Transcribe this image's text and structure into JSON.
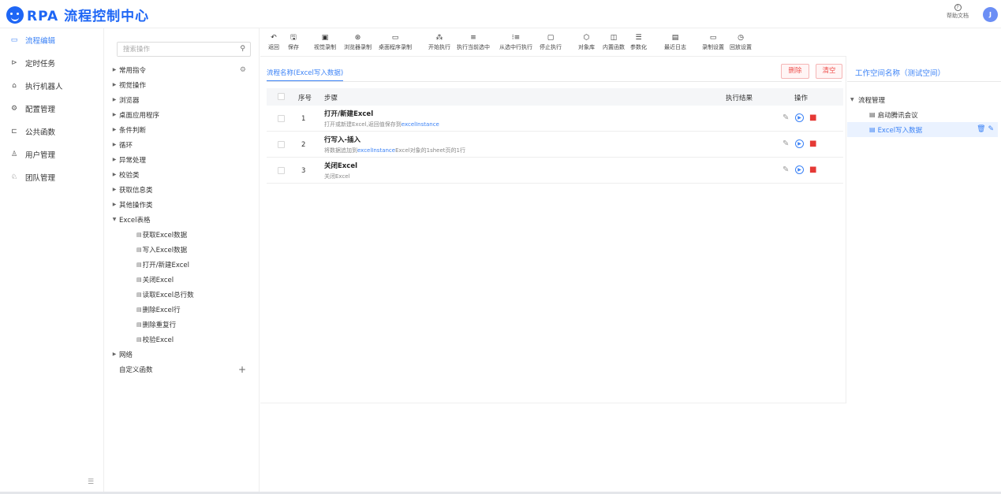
{
  "app": {
    "title": "RPA 流程控制中心",
    "help_label": "帮助文档",
    "avatar_letter": "J"
  },
  "nav": {
    "items": [
      {
        "label": "流程编辑",
        "icon": "monitor-icon"
      },
      {
        "label": "定时任务",
        "icon": "play-icon"
      },
      {
        "label": "执行机器人",
        "icon": "robot-icon"
      },
      {
        "label": "配置管理",
        "icon": "settings-icon"
      },
      {
        "label": "公共函数",
        "icon": "function-icon"
      },
      {
        "label": "用户管理",
        "icon": "user-icon"
      },
      {
        "label": "团队管理",
        "icon": "team-icon"
      }
    ],
    "active_index": 0
  },
  "ops": {
    "search_placeholder": "搜索操作",
    "categories": [
      "常用指令",
      "视觉操作",
      "浏览器",
      "桌面应用程序",
      "条件判断",
      "循环",
      "异常处理",
      "校验类",
      "获取信息类",
      "其他操作类",
      "Excel表格"
    ],
    "excel_items": [
      "获取Excel数据",
      "写入Excel数据",
      "打开/新建Excel",
      "关闭Excel",
      "读取Excel总行数",
      "删除Excel行",
      "删除重复行",
      "校验Excel"
    ],
    "after": [
      "网络"
    ],
    "custom_func": "自定义函数"
  },
  "toolbar": {
    "items": [
      {
        "label": "返回",
        "icon": "↶"
      },
      {
        "label": "保存",
        "icon": "🖫"
      },
      {
        "label": "视觉录制",
        "icon": "▣"
      },
      {
        "label": "浏览器录制",
        "icon": "⊛"
      },
      {
        "label": "桌面程序录制",
        "icon": "▭"
      },
      {
        "label": "开始执行",
        "icon": "⁂"
      },
      {
        "label": "执行当前选中",
        "icon": "≡"
      },
      {
        "label": "从选中行执行",
        "icon": "⁝≡"
      },
      {
        "label": "停止执行",
        "icon": "▢"
      },
      {
        "label": "对象库",
        "icon": "⬡"
      },
      {
        "label": "内置函数",
        "icon": "◫"
      },
      {
        "label": "参数化",
        "icon": "☰"
      },
      {
        "label": "最近日志",
        "icon": "▤"
      },
      {
        "label": "录制设置",
        "icon": "▭"
      },
      {
        "label": "回放设置",
        "icon": "◷"
      }
    ]
  },
  "main": {
    "tab": "流程名称(Excel写入数据)",
    "delete_label": "删除",
    "clear_label": "清空",
    "headers": {
      "index": "序号",
      "step": "步骤",
      "result": "执行结果",
      "action": "操作"
    },
    "rows": [
      {
        "index": "1",
        "title": "打开/新建Excel",
        "desc_prefix": "打开或新建Excel,返回值保存到",
        "desc_hl": "excelInstance",
        "desc_suffix": ""
      },
      {
        "index": "2",
        "title": "行写入-插入",
        "desc_prefix": "将数据追加到",
        "desc_hl": "excelInstance",
        "desc_suffix": "Excel对象的1sheet页的1行"
      },
      {
        "index": "3",
        "title": "关闭Excel",
        "desc_prefix": "关闭Excel",
        "desc_hl": "",
        "desc_suffix": ""
      }
    ]
  },
  "workspace": {
    "title": "工作空间名称（测试空间）",
    "root": "流程管理",
    "items": [
      "启动腾讯会议",
      "Excel写入数据"
    ],
    "selected_index": 1
  }
}
